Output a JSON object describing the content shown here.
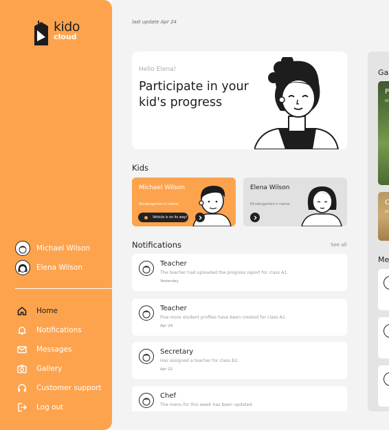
{
  "brand": {
    "name": "kido",
    "sub": "cloud"
  },
  "sidebar": {
    "kids": [
      {
        "name": "Michael Wilson"
      },
      {
        "name": "Elena Wilson"
      }
    ],
    "nav": [
      {
        "label": "Home",
        "icon": "home-icon",
        "active": true
      },
      {
        "label": "Notifications",
        "icon": "bell-icon"
      },
      {
        "label": "Messages",
        "icon": "mail-icon"
      },
      {
        "label": "Gallery",
        "icon": "camera-icon"
      },
      {
        "label": "Customer support",
        "icon": "headphones-icon"
      },
      {
        "label": "Log out",
        "icon": "logout-icon"
      }
    ]
  },
  "header": {
    "last_update": "last update Apr 24"
  },
  "hero": {
    "greeting": "Hello Elena!",
    "title": "Participate in your kid's progress"
  },
  "kids_section": {
    "heading": "Kids",
    "cards": [
      {
        "name": "Michael Wilson",
        "sub": "Kindergarten's name",
        "status": "Vehicle is on its way!"
      },
      {
        "name": "Elena Wilson",
        "sub": "Kindergarten's name"
      }
    ]
  },
  "notifications": {
    "heading": "Notifications",
    "see_all": "See all",
    "items": [
      {
        "title": "Teacher",
        "text": "The teacher had uploaded the progress report for class A1.",
        "time": "Yesterday"
      },
      {
        "title": "Teacher",
        "text": "Five more student profiles have been created for class A1.",
        "time": "Apr 24"
      },
      {
        "title": "Secretary",
        "text": "Has assigned a teacher for class B2.",
        "time": "Apr 22"
      },
      {
        "title": "Chef",
        "text": "The menu for this week has been updated."
      }
    ]
  },
  "right_panel": {
    "gallery_heading": "Ga",
    "gallery_items": [
      {
        "label": "P",
        "sub": "05"
      },
      {
        "label": "C",
        "sub": "05"
      }
    ],
    "messages_heading": "Me"
  },
  "colors": {
    "accent": "#fda34e",
    "dark": "#1d1d1d",
    "background": "#f3f3f3"
  }
}
